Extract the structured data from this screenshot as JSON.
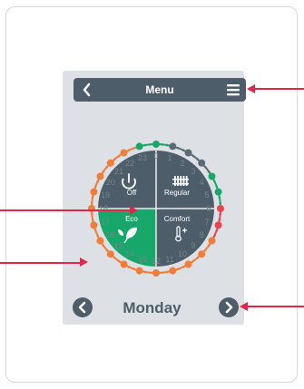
{
  "header": {
    "title": "Menu",
    "back_icon": "chevron-left-icon",
    "menu_icon": "hamburger-menu-icon"
  },
  "modes": [
    {
      "id": "off",
      "label": "Off",
      "icon": "power-icon",
      "color": "#4e5d6a"
    },
    {
      "id": "regular",
      "label": "Regular",
      "icon": "radiator-icon",
      "color": "#4e5d6a"
    },
    {
      "id": "eco",
      "label": "Eco",
      "icon": "leaf-icon",
      "color": "#17a76a",
      "selected": true
    },
    {
      "id": "comfort",
      "label": "Comfort",
      "icon": "thermometer-up-icon",
      "color": "#4e5d6a"
    }
  ],
  "hours": [
    "0",
    "1",
    "2",
    "3",
    "4",
    "5",
    "6",
    "7",
    "8",
    "9",
    "10",
    "11",
    "12",
    "13",
    "14",
    "15",
    "16",
    "17",
    "18",
    "19",
    "20",
    "21",
    "22",
    "23"
  ],
  "schedule_colors": {
    "green": "#1aa86a",
    "orange": "#f07d3a",
    "gray": "#5d6b76",
    "red": "#e8454f"
  },
  "schedule_dots": [
    "green",
    "gray",
    "gray",
    "gray",
    "green",
    "green",
    "red",
    "red",
    "orange",
    "orange",
    "orange",
    "orange",
    "orange",
    "orange",
    "orange",
    "orange",
    "orange",
    "orange",
    "orange",
    "orange",
    "orange",
    "orange",
    "orange",
    "green"
  ],
  "day_navigation": {
    "day": "Monday",
    "prev_icon": "chevron-left-icon",
    "next_icon": "chevron-right-icon"
  },
  "annotation_color": "#e2264a"
}
